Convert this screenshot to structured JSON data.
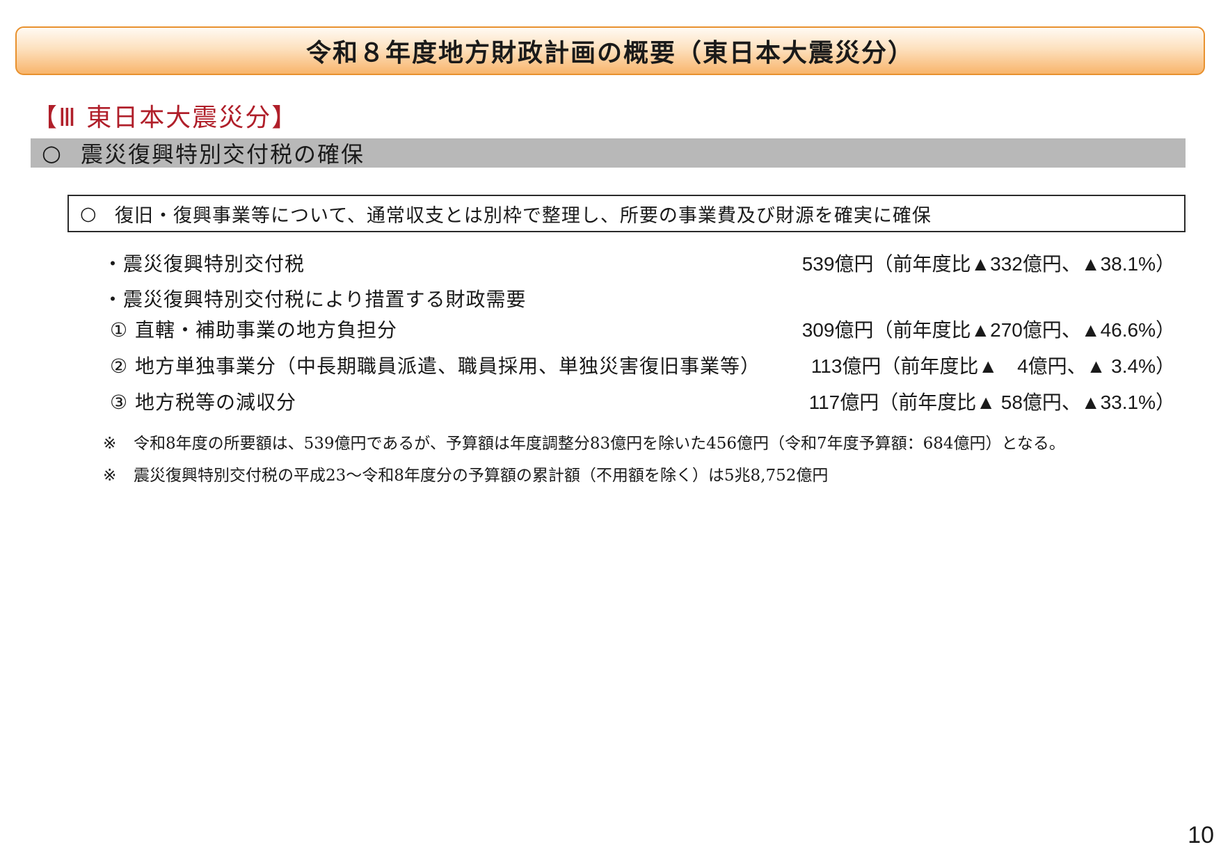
{
  "title": "令和８年度地方財政計画の概要（東日本大震災分）",
  "section_heading": "【Ⅲ 東日本大震災分】",
  "subheading": {
    "mark": "○",
    "text": "震災復興特別交付税の確保"
  },
  "summary": {
    "mark": "○",
    "text": "復旧・復興事業等について、通常収支とは別枠で整理し、所要の事業費及び財源を確実に確保"
  },
  "items": [
    {
      "label": "・震災復興特別交付税",
      "amount": "539億円（前年度比▲332億円、▲38.1%）"
    },
    {
      "label": "・震災復興特別交付税により措置する財政需要",
      "amount": ""
    },
    {
      "label": "① 直轄・補助事業の地方負担分",
      "amount": "309億円（前年度比▲270億円、▲46.6%）"
    },
    {
      "label": "② 地方単独事業分（中長期職員派遣、職員採用、単独災害復旧事業等）",
      "amount": "113億円（前年度比▲　4億円、▲ 3.4%）"
    },
    {
      "label": "③ 地方税等の減収分",
      "amount": "117億円（前年度比▲ 58億円、▲33.1%）"
    }
  ],
  "notes": [
    {
      "mark": "※",
      "text": "令和8年度の所要額は、539億円であるが、予算額は年度調整分83億円を除いた456億円（令和7年度予算額：684億円）となる。"
    },
    {
      "mark": "※",
      "text": "震災復興特別交付税の平成23～令和8年度分の予算額の累計額（不用額を除く）は5兆8,752億円"
    }
  ],
  "page_number": "10",
  "colors": {
    "banner_border": "#e8912e",
    "banner_fill": "#f8b56c",
    "section_heading": "#b01f2a",
    "subheading_bar": "#b8b8b8"
  }
}
